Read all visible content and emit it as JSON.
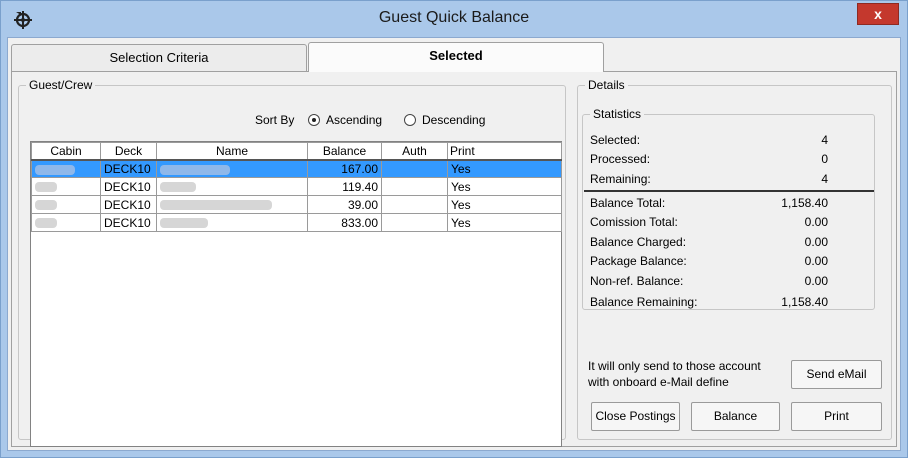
{
  "window": {
    "title": "Guest Quick Balance",
    "close_label": "x"
  },
  "tabs": [
    {
      "label": "Selection Criteria"
    },
    {
      "label": "Selected"
    }
  ],
  "guest_crew": {
    "legend": "Guest/Crew",
    "sort_by_label": "Sort By",
    "ascending_label": "Ascending",
    "descending_label": "Descending",
    "selected_sort": "Ascending",
    "columns": [
      "Cabin",
      "Deck",
      "Name",
      "Balance",
      "Auth",
      "Print"
    ],
    "rows": [
      {
        "deck": "DECK10",
        "balance": "167.00",
        "auth": "",
        "print": "Yes",
        "selected": true
      },
      {
        "deck": "DECK10",
        "balance": "119.40",
        "auth": "",
        "print": "Yes",
        "selected": false
      },
      {
        "deck": "DECK10",
        "balance": "39.00",
        "auth": "",
        "print": "Yes",
        "selected": false
      },
      {
        "deck": "DECK10",
        "balance": "833.00",
        "auth": "",
        "print": "Yes",
        "selected": false
      }
    ]
  },
  "details": {
    "legend": "Details",
    "statistics_legend": "Statistics",
    "stats": [
      {
        "label": "Selected:",
        "value": "4"
      },
      {
        "label": "Processed:",
        "value": "0"
      },
      {
        "label": "Remaining:",
        "value": "4"
      }
    ],
    "totals": [
      {
        "label": "Balance Total:",
        "value": "1,158.40"
      },
      {
        "label": "Comission Total:",
        "value": "0.00"
      },
      {
        "label": "Balance Charged:",
        "value": "0.00"
      },
      {
        "label": "Package Balance:",
        "value": "0.00"
      },
      {
        "label": "Non-ref. Balance:",
        "value": "0.00"
      },
      {
        "label": "Balance Remaining:",
        "value": "1,158.40"
      }
    ],
    "email_note_line1": "It will only send to those account",
    "email_note_line2": "with onboard e-Mail define",
    "send_email_label": "Send eMail",
    "close_postings_label": "Close Postings",
    "balance_label": "Balance",
    "print_label": "Print"
  },
  "icons": {
    "app": "ship-wheel-icon",
    "close": "close-icon"
  },
  "colors": {
    "title_bg": "#aac8ea",
    "selection": "#3399ff",
    "close_button": "#c4382d"
  }
}
